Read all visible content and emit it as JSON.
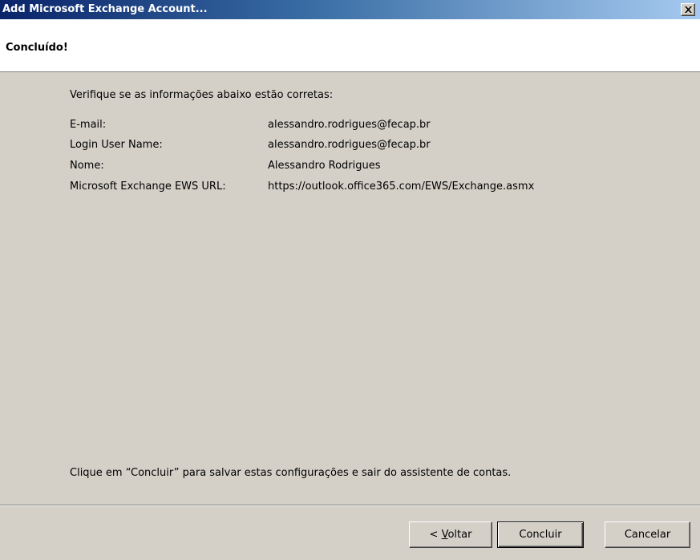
{
  "window": {
    "title": "Add Microsoft Exchange Account..."
  },
  "header": {
    "title": "Concluído!"
  },
  "content": {
    "intro": "Verifique se as informações abaixo estão corretas:",
    "fields": [
      {
        "label": "E-mail:",
        "value": "alessandro.rodrigues@fecap.br"
      },
      {
        "label": "Login User Name:",
        "value": "alessandro.rodrigues@fecap.br"
      },
      {
        "label": "Nome:",
        "value": "Alessandro Rodrigues"
      },
      {
        "label": "Microsoft Exchange EWS URL:",
        "value": "https://outlook.office365.com/EWS/Exchange.asmx"
      }
    ],
    "footer_note": "Clique em “Concluir” para salvar estas configurações e sair do assistente de contas."
  },
  "buttons": {
    "back_prefix": "< ",
    "back_mnemonic": "V",
    "back_rest": "oltar",
    "finish": "Concluir",
    "cancel": "Cancelar"
  },
  "icons": {
    "close": "close-icon"
  }
}
